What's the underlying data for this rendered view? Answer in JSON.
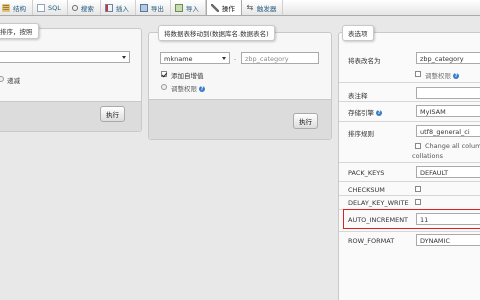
{
  "tabs": [
    {
      "icon": "database-icon",
      "label": "结构"
    },
    {
      "icon": "sql-icon",
      "label": "SQL"
    },
    {
      "icon": "search-icon",
      "label": "搜索"
    },
    {
      "icon": "insert-icon",
      "label": "插入"
    },
    {
      "icon": "export-icon",
      "label": "导出"
    },
    {
      "icon": "import-icon",
      "label": "导入"
    },
    {
      "icon": "wrench-icon",
      "label": "操作"
    },
    {
      "icon": "trigger-icon",
      "label": "触发器"
    }
  ],
  "panel_left": {
    "legend": "排序，按照",
    "select_value": "",
    "option_text": "递减",
    "go_button": "执行"
  },
  "panel_middle": {
    "legend": "将数据表移动到(数据库名.数据表名)",
    "db_select": "mkname",
    "dot": ".",
    "table_name_placeholder": "zbp_category",
    "add_auto_increment": "添加自增值",
    "adjust_privileges": "调整权限",
    "go_button": "执行"
  },
  "panel_right": {
    "legend": "表选项",
    "rename_label": "将表改名为",
    "rename_value": "zbp_category",
    "adjust_privileges": "调整权限",
    "comment_label": "表注释",
    "comment_value": "",
    "engine_label": "存储引擎",
    "engine_value": "MyISAM",
    "collation_label": "排序规则",
    "collation_value": "utf8_general_ci",
    "change_all_columns": "Change all colum",
    "change_all_columns_2": "collations",
    "pack_keys_label": "PACK_KEYS",
    "pack_keys_value": "DEFAULT",
    "checksum_label": "CHECKSUM",
    "delay_key_write_label": "DELAY_KEY_WRITE",
    "auto_increment_label": "AUTO_INCREMENT",
    "auto_increment_value": "11",
    "row_format_label": "ROW_FORMAT",
    "row_format_value": "DYNAMIC"
  },
  "colors": {
    "highlight": "#e02020",
    "link": "#235a81",
    "help_icon": "#3b7cc4"
  }
}
